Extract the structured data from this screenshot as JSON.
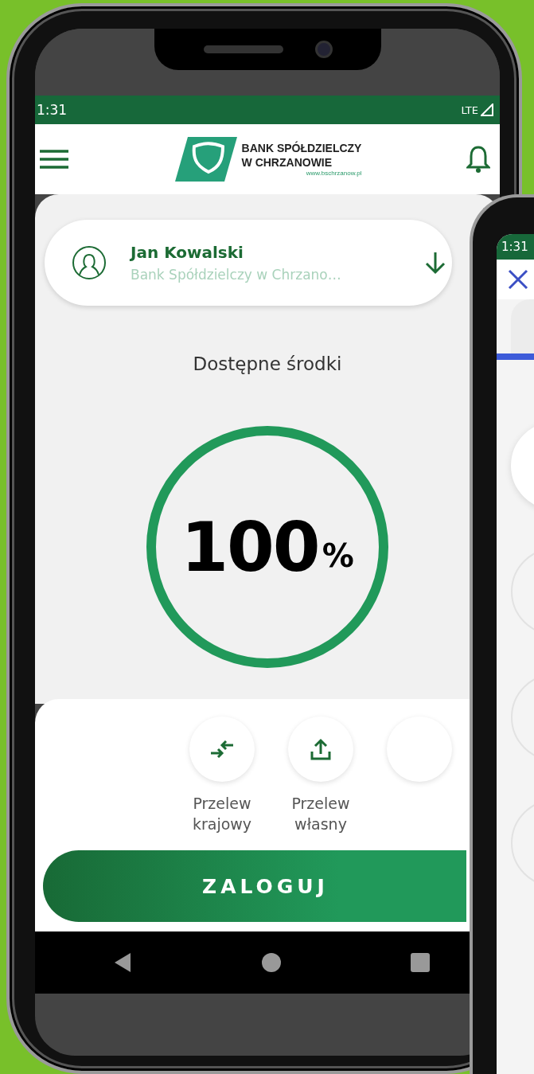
{
  "status_bar": {
    "time": "1:31",
    "network": "LTE"
  },
  "header": {
    "logo_lines": [
      "BANK SPÓŁDZIELCZY",
      "W CHRZANOWIE"
    ],
    "logo_url": "www.bschrzanow.pl"
  },
  "account": {
    "name": "Jan Kowalski",
    "bank": "Bank Spółdzielczy w Chrzano…"
  },
  "balance": {
    "label": "Dostępne środki",
    "value": "100",
    "unit": "%",
    "level": 1
  },
  "quick_actions": [
    {
      "kind": "transfer",
      "label": "Przelew krajowy"
    },
    {
      "kind": "upload",
      "label": "Przelew własny"
    },
    {
      "kind": "blank"
    }
  ],
  "login_button": "ZALOGUJ",
  "second_phone": {
    "time": "1:31"
  }
}
